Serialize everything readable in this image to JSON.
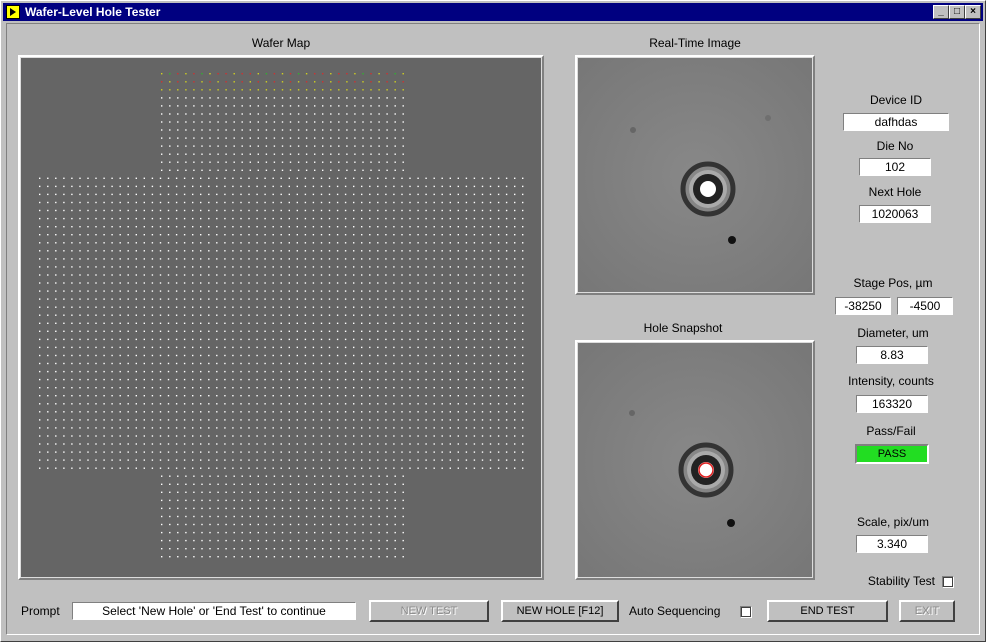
{
  "window": {
    "title": "Wafer-Level Hole Tester"
  },
  "wafer_map": {
    "label": "Wafer Map",
    "background": "#656565",
    "dot_color": "#ffffff",
    "fail_color": "#d03030",
    "warn_color": "#d0d020",
    "pass_color": "#30b030"
  },
  "realtime": {
    "label": "Real-Time Image"
  },
  "snapshot": {
    "label": "Hole Snapshot"
  },
  "fields": {
    "device_id_label": "Device ID",
    "device_id": "dafhdas",
    "die_no_label": "Die No",
    "die_no": "102",
    "next_hole_label": "Next Hole",
    "next_hole": "1020063",
    "stage_pos_label": "Stage Pos, µm",
    "stage_x": "-38250",
    "stage_y": "-4500",
    "diameter_label": "Diameter, um",
    "diameter": "8.83",
    "intensity_label": "Intensity, counts",
    "intensity": "163320",
    "passfail_label": "Pass/Fail",
    "passfail": "PASS",
    "passfail_color": "#22dd22",
    "scale_label": "Scale, pix/um",
    "scale": "3.340",
    "stability_label": "Stability Test"
  },
  "bottom": {
    "prompt_label": "Prompt",
    "prompt_text": "Select 'New Hole' or 'End Test' to continue",
    "new_test": "NEW TEST",
    "new_hole": "NEW HOLE [F12]",
    "auto_seq": "Auto Sequencing",
    "end_test": "END TEST",
    "exit": "EXIT"
  }
}
